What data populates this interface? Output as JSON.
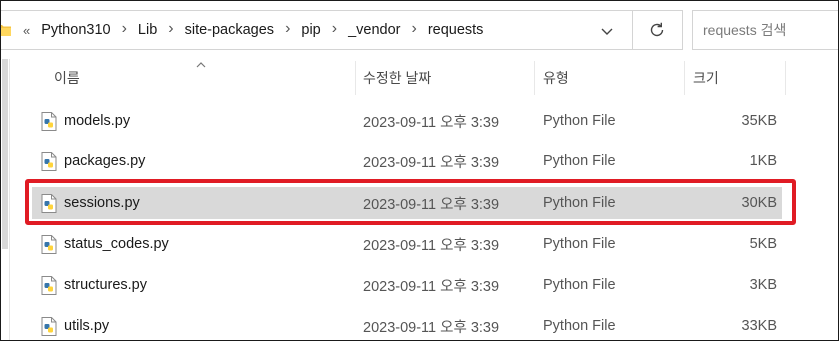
{
  "address_bar": {
    "overflow": "«",
    "breadcrumbs": [
      "Python310",
      "Lib",
      "site-packages",
      "pip",
      "_vendor",
      "requests"
    ]
  },
  "search": {
    "placeholder": "requests 검색"
  },
  "columns": {
    "name": "이름",
    "date": "수정한 날짜",
    "type": "유형",
    "size": "크기"
  },
  "files": [
    {
      "name": "models.py",
      "date": "2023-09-11 오후 3:39",
      "type": "Python File",
      "size": "35KB",
      "selected": false
    },
    {
      "name": "packages.py",
      "date": "2023-09-11 오후 3:39",
      "type": "Python File",
      "size": "1KB",
      "selected": false
    },
    {
      "name": "sessions.py",
      "date": "2023-09-11 오후 3:39",
      "type": "Python File",
      "size": "30KB",
      "selected": true
    },
    {
      "name": "status_codes.py",
      "date": "2023-09-11 오후 3:39",
      "type": "Python File",
      "size": "5KB",
      "selected": false
    },
    {
      "name": "structures.py",
      "date": "2023-09-11 오후 3:39",
      "type": "Python File",
      "size": "3KB",
      "selected": false
    },
    {
      "name": "utils.py",
      "date": "2023-09-11 오후 3:39",
      "type": "Python File",
      "size": "33KB",
      "selected": false
    }
  ],
  "icons": {
    "folder": "folder-icon",
    "refresh": "refresh-icon",
    "dropdown": "chevron-down-icon",
    "file": "python-file-icon"
  },
  "colors": {
    "highlight": "#e01b24",
    "selected_row": "#d9d9d9",
    "folder": "#f5c342"
  }
}
